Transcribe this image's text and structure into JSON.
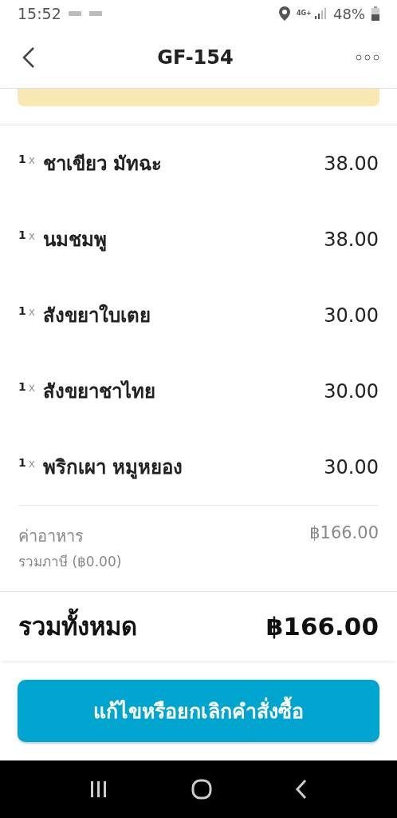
{
  "status_bar": {
    "time": "15:52",
    "network": "4G+",
    "battery": "48%"
  },
  "header": {
    "title": "GF-154"
  },
  "items": [
    {
      "quantity": "1",
      "multiplier": "x",
      "name": "ชาเขียว มัทฉะ",
      "price": "38.00"
    },
    {
      "quantity": "1",
      "multiplier": "x",
      "name": "นมชมพู",
      "price": "38.00"
    },
    {
      "quantity": "1",
      "multiplier": "x",
      "name": "สังขยาใบเตย",
      "price": "30.00"
    },
    {
      "quantity": "1",
      "multiplier": "x",
      "name": "สังขยาชาไทย",
      "price": "30.00"
    },
    {
      "quantity": "1",
      "multiplier": "x",
      "name": "พริกเผา หมูหยอง",
      "price": "30.00"
    }
  ],
  "subtotal": {
    "label": "ค่าอาหาร",
    "tax_note": "รวมภาษี (฿0.00)",
    "amount": "฿166.00"
  },
  "total": {
    "label": "รวมทั้งหมด",
    "amount": "฿166.00"
  },
  "action_button": "แก้ไขหรือยกเลิกคำสั่งซื้อ"
}
